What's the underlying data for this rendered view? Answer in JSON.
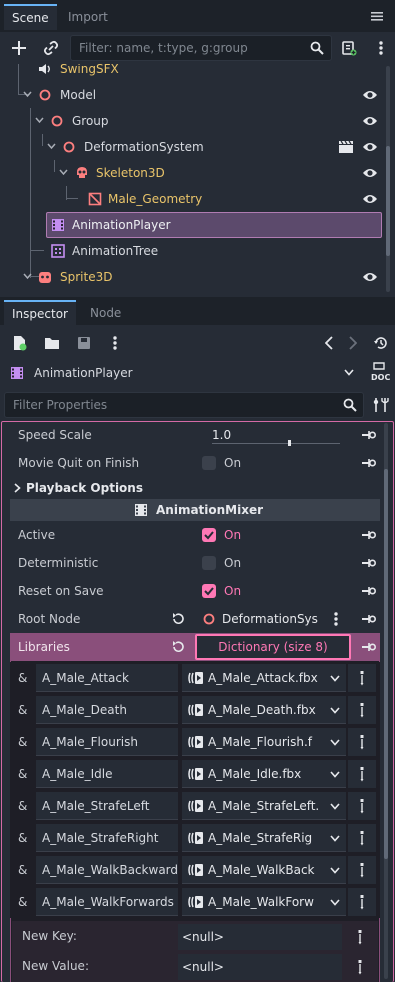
{
  "scene_dock": {
    "tabs": [
      {
        "label": "Scene"
      },
      {
        "label": "Import"
      }
    ],
    "filter_placeholder": "Filter: name, t:type, g:group",
    "nodes": [
      {
        "label": "SwingSFX",
        "color": "#e9c46a"
      },
      {
        "label": "Model",
        "color": "#d7dae0"
      },
      {
        "label": "Group",
        "color": "#d7dae0"
      },
      {
        "label": "DeformationSystem",
        "color": "#d7dae0"
      },
      {
        "label": "Skeleton3D",
        "color": "#e9c46a"
      },
      {
        "label": "Male_Geometry",
        "color": "#e9c46a"
      },
      {
        "label": "AnimationPlayer",
        "color": "#d7dae0"
      },
      {
        "label": "AnimationTree",
        "color": "#d7dae0"
      },
      {
        "label": "Sprite3D",
        "color": "#e9c46a"
      }
    ]
  },
  "inspector": {
    "tabs": [
      {
        "label": "Inspector"
      },
      {
        "label": "Node"
      }
    ],
    "object_name": "AnimationPlayer",
    "doc_label": "DOC",
    "filter_placeholder": "Filter Properties",
    "speed_scale": {
      "label": "Speed Scale",
      "value": "1.0"
    },
    "movie_quit": {
      "label": "Movie Quit on Finish",
      "value": "On"
    },
    "playback_section": "Playback Options",
    "mixer_section": "AnimationMixer",
    "active": {
      "label": "Active",
      "value": "On"
    },
    "deterministic": {
      "label": "Deterministic",
      "value": "On"
    },
    "reset_on_save": {
      "label": "Reset on Save",
      "value": "On"
    },
    "root_node": {
      "label": "Root Node",
      "value": "DeformationSys"
    },
    "libraries": {
      "label": "Libraries",
      "value": "Dictionary (size 8)"
    },
    "library_entries": [
      {
        "amp": "&",
        "key": "A_Male_Attack",
        "value": "A_Male_Attack.fbx"
      },
      {
        "amp": "&",
        "key": "A_Male_Death",
        "value": "A_Male_Death.fbx"
      },
      {
        "amp": "&",
        "key": "A_Male_Flourish",
        "value": "A_Male_Flourish.f"
      },
      {
        "amp": "&",
        "key": "A_Male_Idle",
        "value": "A_Male_Idle.fbx"
      },
      {
        "amp": "&",
        "key": "A_Male_StrafeLeft",
        "value": "A_Male_StrafeLeft."
      },
      {
        "amp": "&",
        "key": "A_Male_StrafeRight",
        "value": "A_Male_StrafeRig"
      },
      {
        "amp": "&",
        "key": "A_Male_WalkBackward",
        "value": "A_Male_WalkBack"
      },
      {
        "amp": "&",
        "key": "A_Male_WalkForwards",
        "value": "A_Male_WalkForw"
      }
    ],
    "new_key": {
      "label": "New Key:",
      "value": "<null>"
    },
    "new_value": {
      "label": "New Value:",
      "value": "<null>"
    }
  },
  "colors": {
    "accent": "#68b3f5",
    "pink": "#ff78b5",
    "libraries_bg": "#8a4f7b"
  }
}
